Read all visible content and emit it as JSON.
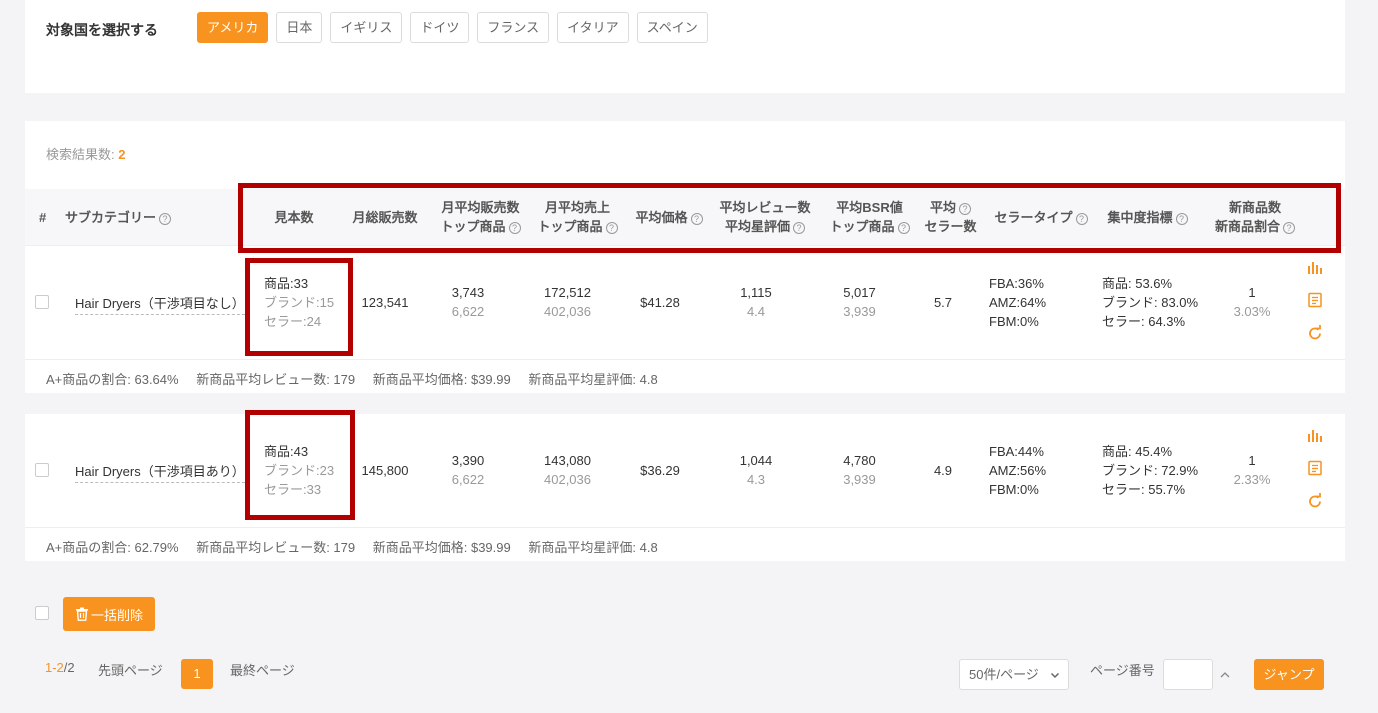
{
  "country": {
    "label": "対象国を選択する",
    "options": [
      "アメリカ",
      "日本",
      "イギリス",
      "ドイツ",
      "フランス",
      "イタリア",
      "スペイン"
    ],
    "selected": "アメリカ"
  },
  "results": {
    "label": "検索結果数:",
    "count": "2"
  },
  "table": {
    "headers": {
      "index": "#",
      "subcategory": "サブカテゴリー",
      "listings": "見本数",
      "monthly_sales": "月総販売数",
      "avg_sales_1": "月平均販売数",
      "avg_sales_2": "トップ商品",
      "avg_revenue_1": "月平均売上",
      "avg_revenue_2": "トップ商品",
      "avg_price": "平均価格",
      "avg_review_1": "平均レビュー数",
      "avg_review_2": "平均星評価",
      "avg_bsr_1": "平均BSR値",
      "avg_bsr_2": "トップ商品",
      "avg_seller_1": "平均",
      "avg_seller_2": "セラー数",
      "seller_type": "セラータイプ",
      "concentration": "集中度指標",
      "new_1": "新商品数",
      "new_2": "新商品割合"
    },
    "rows": [
      {
        "subcategory": "Hair Dryers（干渉項目なし）",
        "products": "商品:33",
        "brands": "ブランド:15",
        "sellers": "セラー:24",
        "monthly_sales": "123,541",
        "avg_sales": "3,743",
        "avg_sales_top": "6,622",
        "avg_revenue": "172,512",
        "avg_revenue_top": "402,036",
        "avg_price": "$41.28",
        "avg_review": "1,115",
        "avg_rating": "4.4",
        "avg_bsr": "5,017",
        "avg_bsr_top": "3,939",
        "avg_sellers": "5.7",
        "fba": "FBA:36%",
        "amz": "AMZ:64%",
        "fbm": "FBM:0%",
        "conc_products": "商品: 53.6%",
        "conc_brands": "ブランド: 83.0%",
        "conc_sellers": "セラー: 64.3%",
        "new_count": "1",
        "new_ratio": "3.03%",
        "summary": {
          "aplus": "A+商品の割合: 63.64%",
          "new_review": "新商品平均レビュー数: 179",
          "new_price": "新商品平均価格: $39.99",
          "new_rating": "新商品平均星評価: 4.8"
        }
      },
      {
        "subcategory": "Hair Dryers（干渉項目あり）",
        "products": "商品:43",
        "brands": "ブランド:23",
        "sellers": "セラー:33",
        "monthly_sales": "145,800",
        "avg_sales": "3,390",
        "avg_sales_top": "6,622",
        "avg_revenue": "143,080",
        "avg_revenue_top": "402,036",
        "avg_price": "$36.29",
        "avg_review": "1,044",
        "avg_rating": "4.3",
        "avg_bsr": "4,780",
        "avg_bsr_top": "3,939",
        "avg_sellers": "4.9",
        "fba": "FBA:44%",
        "amz": "AMZ:56%",
        "fbm": "FBM:0%",
        "conc_products": "商品: 45.4%",
        "conc_brands": "ブランド: 72.9%",
        "conc_sellers": "セラー: 55.7%",
        "new_count": "1",
        "new_ratio": "2.33%",
        "summary": {
          "aplus": "A+商品の割合: 62.79%",
          "new_review": "新商品平均レビュー数: 179",
          "new_price": "新商品平均価格: $39.99",
          "new_rating": "新商品平均星評価: 4.8"
        }
      }
    ]
  },
  "footer": {
    "bulk_delete": "一括削除",
    "page_info_current": "1-2",
    "page_info_total": "/2",
    "first_page": "先頭ページ",
    "current_page": "1",
    "last_page": "最終ページ",
    "page_size": "50件/ページ",
    "page_number_label": "ページ番号",
    "jump": "ジャンプ"
  },
  "colors": {
    "accent": "#f7931e",
    "highlight_frame": "#b20000"
  },
  "icons": [
    "bar-chart-icon",
    "document-icon",
    "refresh-icon",
    "trash-icon",
    "question-icon",
    "chevron-down-icon",
    "chevron-up-icon"
  ]
}
